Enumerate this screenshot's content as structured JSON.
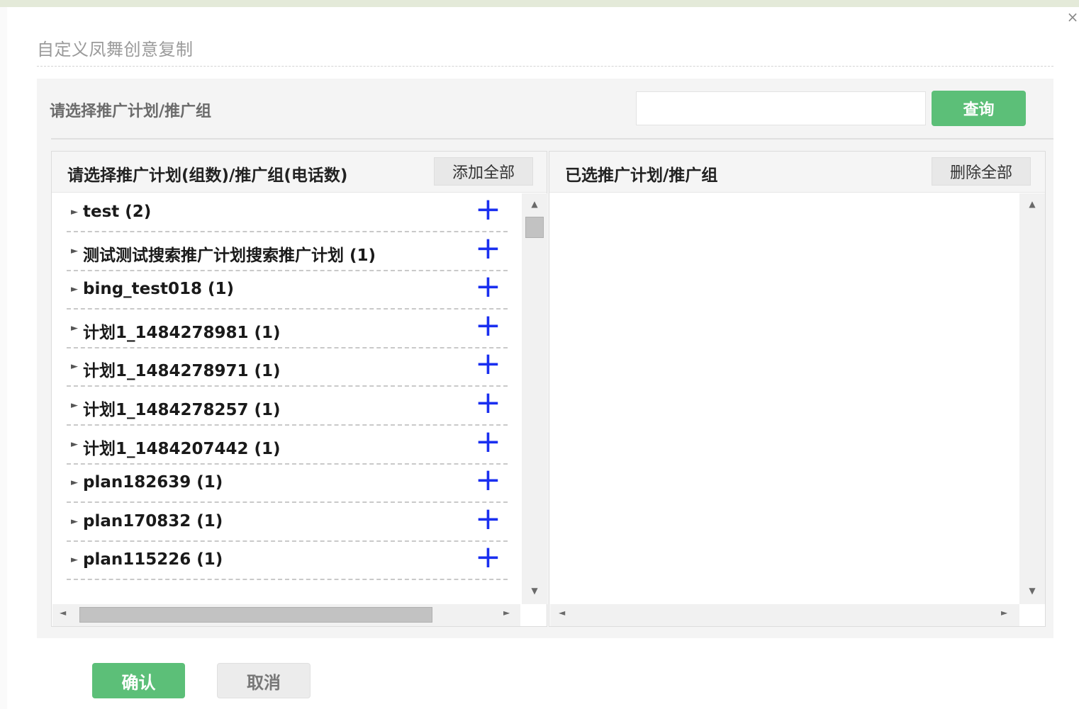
{
  "dialog": {
    "title": "自定义凤舞创意复制",
    "close_glyph": "×"
  },
  "search": {
    "label": "请选择推广计划/推广组",
    "value": "",
    "placeholder": "",
    "button": "查询"
  },
  "left_panel": {
    "header": "请选择推广计划(组数)/推广组(电话数)",
    "add_all": "添加全部",
    "items": [
      {
        "label": "test (2)"
      },
      {
        "label": "测试测试搜索推广计划搜索推广计划 (1)"
      },
      {
        "label": "bing_test018 (1)"
      },
      {
        "label": "计划1_1484278981 (1)"
      },
      {
        "label": "计划1_1484278971 (1)"
      },
      {
        "label": "计划1_1484278257 (1)"
      },
      {
        "label": "计划1_1484207442 (1)"
      },
      {
        "label": "plan182639 (1)"
      },
      {
        "label": "plan170832 (1)"
      },
      {
        "label": "plan115226 (1)"
      }
    ],
    "expand_glyph": "►",
    "add_glyph": "+"
  },
  "right_panel": {
    "header": "已选推广计划/推广组",
    "delete_all": "删除全部"
  },
  "scroll_glyphs": {
    "up": "▲",
    "down": "▼",
    "left": "◄",
    "right": "►"
  },
  "footer": {
    "confirm": "确认",
    "cancel": "取消"
  },
  "colors": {
    "primary_green": "#5cbf78",
    "add_icon_blue": "#1a2ff0"
  }
}
